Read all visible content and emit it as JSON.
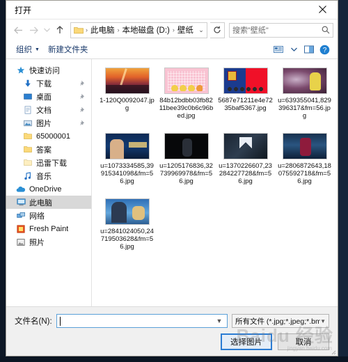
{
  "window": {
    "title": "打开",
    "close_label": "关闭"
  },
  "nav": {
    "back_icon": "arrow-left-icon",
    "forward_icon": "arrow-right-icon",
    "recent_icon": "chevron-down-icon",
    "up_icon": "arrow-up-icon",
    "refresh_icon": "refresh-icon",
    "folder_icon": "folder-icon",
    "breadcrumbs": [
      "此电脑",
      "本地磁盘 (D:)",
      "壁纸"
    ],
    "separator": "›"
  },
  "search": {
    "placeholder": "搜索\"壁纸\"",
    "icon": "search-icon"
  },
  "toolbar": {
    "organize_label": "组织",
    "organize_caret": "▼",
    "new_folder_label": "新建文件夹",
    "view_icon": "view-layout-icon",
    "view_caret": "▼",
    "preview_pane_icon": "preview-pane-icon",
    "help_icon": "help-icon"
  },
  "sidebar": {
    "items": [
      {
        "label": "快速访问",
        "icon": "star-icon",
        "indent": false,
        "pinned": false,
        "selected": false
      },
      {
        "label": "下载",
        "icon": "download-icon",
        "indent": true,
        "pinned": true,
        "selected": false
      },
      {
        "label": "桌面",
        "icon": "desktop-icon",
        "indent": true,
        "pinned": true,
        "selected": false
      },
      {
        "label": "文档",
        "icon": "document-icon",
        "indent": true,
        "pinned": true,
        "selected": false
      },
      {
        "label": "图片",
        "icon": "pictures-icon",
        "indent": true,
        "pinned": true,
        "selected": false
      },
      {
        "label": "65000001",
        "icon": "folder-icon",
        "indent": true,
        "pinned": false,
        "selected": false
      },
      {
        "label": "答案",
        "icon": "folder-icon",
        "indent": true,
        "pinned": false,
        "selected": false
      },
      {
        "label": "迅雷下载",
        "icon": "folder-icon",
        "indent": true,
        "pinned": false,
        "selected": false
      },
      {
        "label": "音乐",
        "icon": "music-icon",
        "indent": true,
        "pinned": false,
        "selected": false
      },
      {
        "label": "OneDrive",
        "icon": "onedrive-icon",
        "indent": false,
        "pinned": false,
        "selected": false
      },
      {
        "label": "此电脑",
        "icon": "this-pc-icon",
        "indent": false,
        "pinned": false,
        "selected": true
      },
      {
        "label": "网络",
        "icon": "network-icon",
        "indent": false,
        "pinned": false,
        "selected": false
      },
      {
        "label": "Fresh Paint",
        "icon": "fresh-paint-icon",
        "indent": false,
        "pinned": false,
        "selected": false
      },
      {
        "label": "照片",
        "icon": "photos-icon",
        "indent": false,
        "pinned": false,
        "selected": false
      }
    ]
  },
  "files": {
    "items": [
      {
        "name": "1-120Q0092047.jpg",
        "art": "t-sunset"
      },
      {
        "name": "84b12bdbb03fb8211bee39c0b6c96bed.jpg",
        "art": "t-pink"
      },
      {
        "name": "5687e71211e4e7235baf5367.jpg",
        "art": "t-barca"
      },
      {
        "name": "u=639355041,829396317&fm=56.jpg",
        "art": "t-anime"
      },
      {
        "name": "u=1073334585,39915341098&fm=56.jpg",
        "art": "t-tv"
      },
      {
        "name": "u=1205176836,32739969978&fm=56.jpg",
        "art": "t-dark"
      },
      {
        "name": "u=1370226607,23284227728&fm=56.jpg",
        "art": "t-messi"
      },
      {
        "name": "u=2806872643,18075592718&fm=56.jpg",
        "art": "t-player"
      },
      {
        "name": "u=2841024050,24719503628&fm=56.jpg",
        "art": "t-conan"
      }
    ]
  },
  "footer": {
    "filename_label": "文件名(N):",
    "filename_value": "",
    "filename_caret": "▼",
    "filetype_value": "所有文件 (*.jpg;*.jpeg;*.bmp;*.",
    "filetype_caret": "▼",
    "confirm_label": "选择图片",
    "cancel_label": "取消"
  },
  "watermark": {
    "main": "Baidu 经验",
    "sub": "jingyan.baidu.com"
  }
}
